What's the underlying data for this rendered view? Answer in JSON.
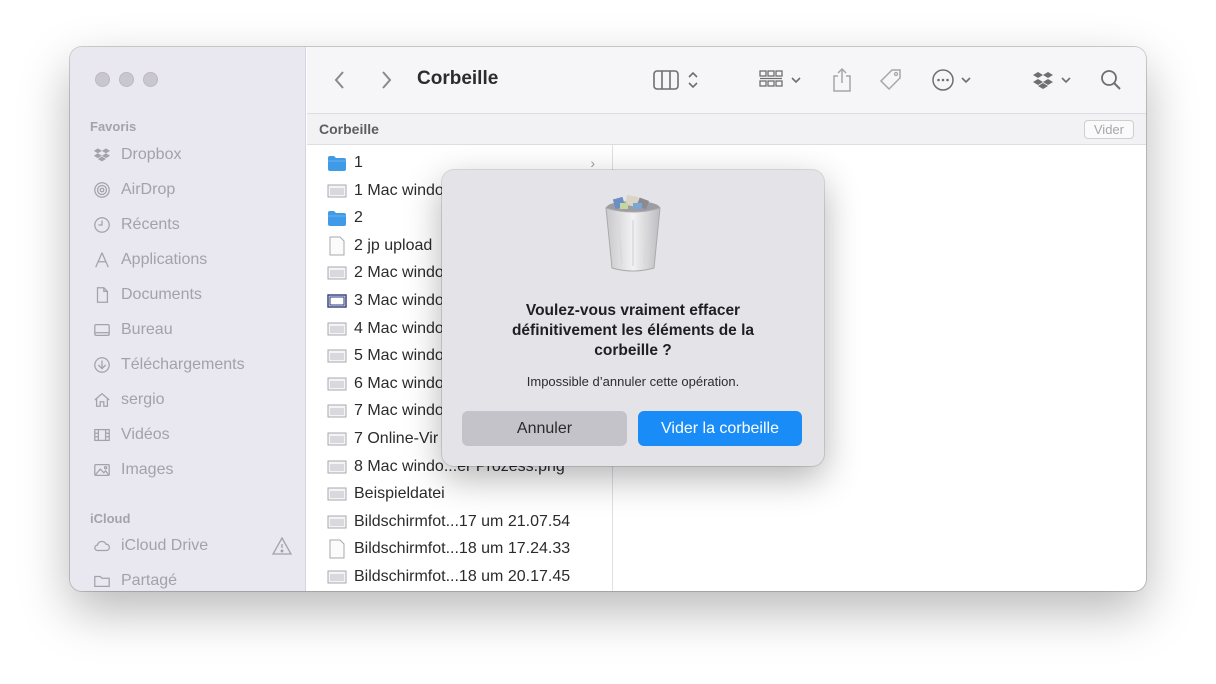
{
  "window": {
    "title": "Corbeille"
  },
  "sidebar": {
    "sections": [
      {
        "label": "Favoris"
      },
      {
        "label": "iCloud"
      }
    ],
    "favorites": [
      {
        "label": "Dropbox",
        "icon": "dropbox-icon"
      },
      {
        "label": "AirDrop",
        "icon": "airdrop-icon"
      },
      {
        "label": "Récents",
        "icon": "clock-icon"
      },
      {
        "label": "Applications",
        "icon": "applications-icon"
      },
      {
        "label": "Documents",
        "icon": "document-icon"
      },
      {
        "label": "Bureau",
        "icon": "desktop-icon"
      },
      {
        "label": "Téléchargements",
        "icon": "download-icon"
      },
      {
        "label": "sergio",
        "icon": "home-icon"
      },
      {
        "label": "Vidéos",
        "icon": "film-icon"
      },
      {
        "label": "Images",
        "icon": "photo-icon"
      }
    ],
    "icloud": [
      {
        "label": "iCloud Drive",
        "icon": "cloud-icon"
      },
      {
        "label": "Partagé",
        "icon": "shared-folder-icon"
      }
    ]
  },
  "toolbar": {
    "back_icon": "chevron-left-icon",
    "forward_icon": "chevron-right-icon",
    "view_icon": "columns-view-icon",
    "group_icon": "grid-group-icon",
    "share_icon": "share-icon",
    "tag_icon": "tag-icon",
    "more_icon": "ellipsis-circle-icon",
    "dropbox_icon": "dropbox-icon",
    "search_icon": "search-icon"
  },
  "pathbar": {
    "title": "Corbeille",
    "empty_button": "Vider"
  },
  "files": [
    {
      "name": "1",
      "type": "folder",
      "has_children": true
    },
    {
      "name": "1 Mac windo",
      "type": "image"
    },
    {
      "name": "2",
      "type": "folder"
    },
    {
      "name": "2 jp upload",
      "type": "doc"
    },
    {
      "name": "2 Mac windo",
      "type": "image"
    },
    {
      "name": "3 Mac windo",
      "type": "image-dark"
    },
    {
      "name": "4 Mac windo",
      "type": "image"
    },
    {
      "name": "5 Mac windo",
      "type": "image"
    },
    {
      "name": "6 Mac windo",
      "type": "image"
    },
    {
      "name": "7 Mac windo",
      "type": "image"
    },
    {
      "name": "7 Online-Vir",
      "type": "image"
    },
    {
      "name": "8 Mac windo...er Prozess.png",
      "type": "image"
    },
    {
      "name": "Beispieldatei",
      "type": "image"
    },
    {
      "name": "Bildschirmfot...17 um 21.07.54",
      "type": "image"
    },
    {
      "name": "Bildschirmfot...18 um 17.24.33",
      "type": "doc"
    },
    {
      "name": "Bildschirmfot...18 um 20.17.45",
      "type": "image"
    }
  ],
  "dialog": {
    "icon": "trash-full-icon",
    "title_line1": "Voulez-vous vraiment effacer",
    "title_line2": "définitivement les éléments de la",
    "title_line3": "corbeille ?",
    "message": "Impossible d’annuler cette opération.",
    "cancel_label": "Annuler",
    "confirm_label": "Vider la corbeille"
  },
  "colors": {
    "accent": "#1a8cf8",
    "folder": "#3f9ae8"
  }
}
